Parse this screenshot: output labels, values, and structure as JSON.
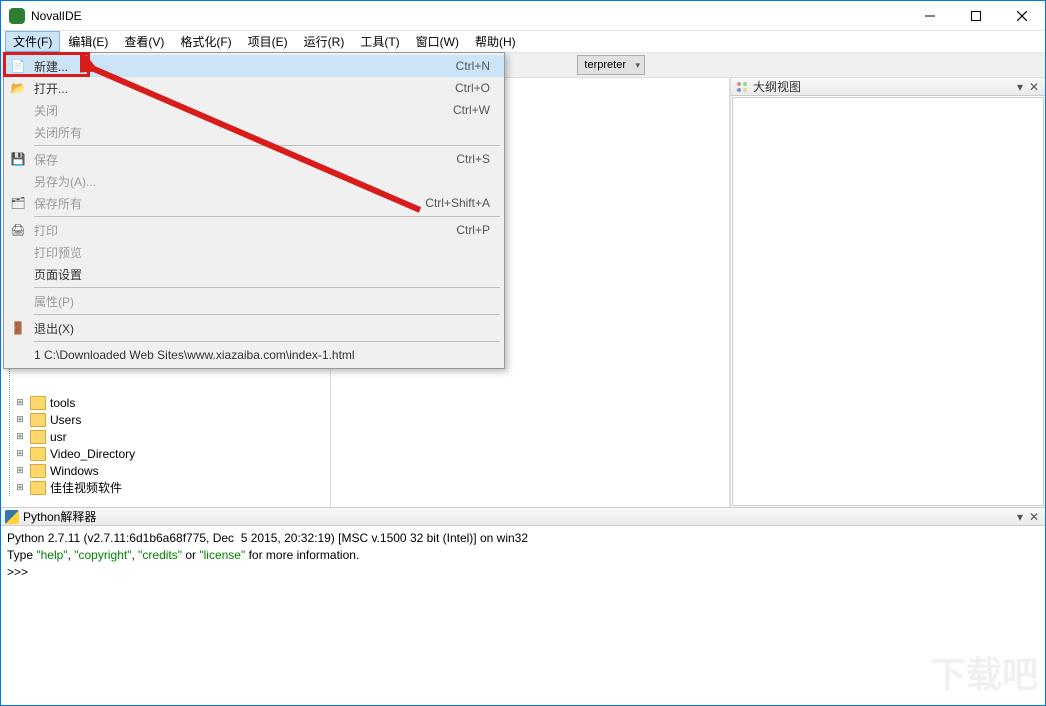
{
  "window": {
    "title": "NovalIDE"
  },
  "menubar": [
    "文件(F)",
    "编辑(E)",
    "查看(V)",
    "格式化(F)",
    "项目(E)",
    "运行(R)",
    "工具(T)",
    "窗口(W)",
    "帮助(H)"
  ],
  "toolbar": {
    "interpreter_combo": "terpreter"
  },
  "file_menu": {
    "items": [
      {
        "label": "新建...",
        "shortcut": "Ctrl+N",
        "icon": "new-file-icon",
        "highlight": true
      },
      {
        "label": "打开...",
        "shortcut": "Ctrl+O",
        "icon": "open-file-icon"
      },
      {
        "label": "关闭",
        "shortcut": "Ctrl+W",
        "disabled": true
      },
      {
        "label": "关闭所有",
        "shortcut": "",
        "disabled": true
      },
      {
        "sep": true
      },
      {
        "label": "保存",
        "shortcut": "Ctrl+S",
        "icon": "save-icon",
        "disabled": true
      },
      {
        "label": "另存为(A)...",
        "shortcut": "",
        "disabled": true
      },
      {
        "label": "保存所有",
        "shortcut": "Ctrl+Shift+A",
        "icon": "save-all-icon",
        "disabled": true
      },
      {
        "sep": true
      },
      {
        "label": "打印",
        "shortcut": "Ctrl+P",
        "icon": "print-icon",
        "disabled": true
      },
      {
        "label": "打印预览",
        "shortcut": "",
        "disabled": true
      },
      {
        "label": "页面设置",
        "shortcut": ""
      },
      {
        "sep": true
      },
      {
        "label": "属性(P)",
        "shortcut": "",
        "disabled": true
      },
      {
        "sep": true
      },
      {
        "label": "退出(X)",
        "shortcut": "",
        "icon": "exit-icon"
      },
      {
        "sep": true
      },
      {
        "label": "1 C:\\Downloaded Web Sites\\www.xiazaiba.com\\index-1.html",
        "shortcut": ""
      }
    ]
  },
  "tree": {
    "items": [
      "tools",
      "Users",
      "usr",
      "Video_Directory",
      "Windows",
      "佳佳视频软件"
    ]
  },
  "outline": {
    "header": "大纲视图"
  },
  "console": {
    "header": "Python解释器",
    "line1_a": "Python 2.7.11 (v2.7.11:6d1b6a68f775, Dec  5 2015, 20:32:19) [MSC v.1500 32 bit (Intel)] on win32",
    "line2_a": "Type ",
    "line2_b": "\"help\"",
    "line2_c": ", ",
    "line2_d": "\"copyright\"",
    "line2_e": ", ",
    "line2_f": "\"credits\"",
    "line2_g": " or ",
    "line2_h": "\"license\"",
    "line2_i": " for more information.",
    "prompt": ">>> "
  },
  "watermark": "下载吧"
}
